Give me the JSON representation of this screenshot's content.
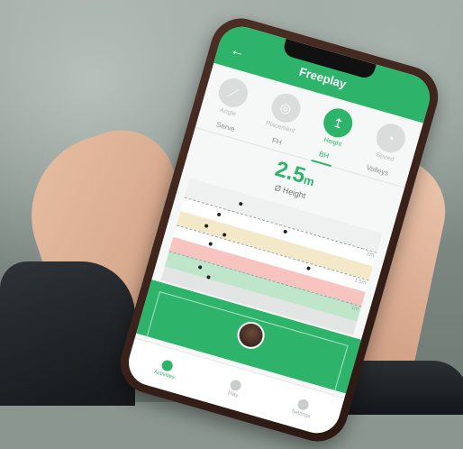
{
  "app": {
    "title": "Freeplay"
  },
  "modes": [
    {
      "label": "Angle",
      "icon": "angle-icon"
    },
    {
      "label": "Placement",
      "icon": "placement-icon"
    },
    {
      "label": "Height",
      "icon": "height-icon",
      "active": true
    },
    {
      "label": "Speed",
      "icon": "speed-icon"
    }
  ],
  "tabs": [
    {
      "label": "Serve"
    },
    {
      "label": "FH"
    },
    {
      "label": "BH",
      "active": true
    },
    {
      "label": "Volleys"
    }
  ],
  "metric": {
    "value": "2.5",
    "unit": "m",
    "label": "Ø Height"
  },
  "zones": {
    "labels": [
      "2m",
      "1.5m",
      "1m"
    ]
  },
  "bottom_nav": [
    {
      "label": "Activities",
      "active": true
    },
    {
      "label": "Play"
    },
    {
      "label": "Settings"
    }
  ],
  "colors": {
    "accent": "#2db46a"
  }
}
